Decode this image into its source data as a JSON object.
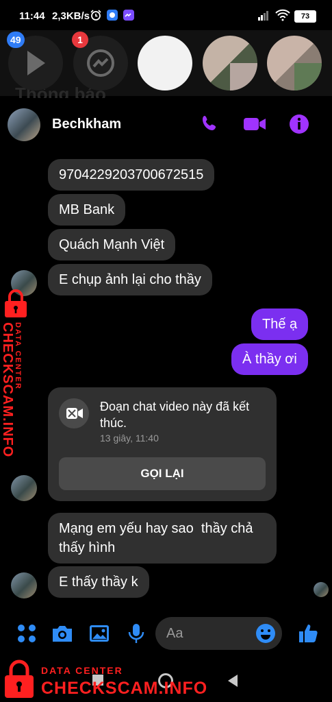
{
  "status_bar": {
    "time": "11:44",
    "network_speed": "2,3KB/s",
    "battery": "73"
  },
  "chat_heads": {
    "badges": [
      "49",
      "1"
    ],
    "background_text": "Thông báo"
  },
  "conversation": {
    "contact_name": "Bechkham",
    "accent_color": "#a033ff"
  },
  "messages": {
    "m1": "9704229203700672515",
    "m2": "MB Bank",
    "m3": "Quách Mạnh Việt",
    "m4": "E chụp ảnh lại cho thầy",
    "m5": "Thế ạ",
    "m6": "À thầy ơi",
    "m7": "Mạng em yếu hay sao  thầy chả\nthấy hình",
    "m8": "E thấy thầy k"
  },
  "video_call": {
    "title": "Đoạn chat video này đã kết thúc.",
    "time": "13 giây, 11:40",
    "button_label": "GỌI LẠI"
  },
  "composer": {
    "placeholder": "Aa"
  },
  "watermark": {
    "line1": "DATA CENTER",
    "line2": "CHECKSCAM.INFO",
    "color": "#ff2020"
  }
}
